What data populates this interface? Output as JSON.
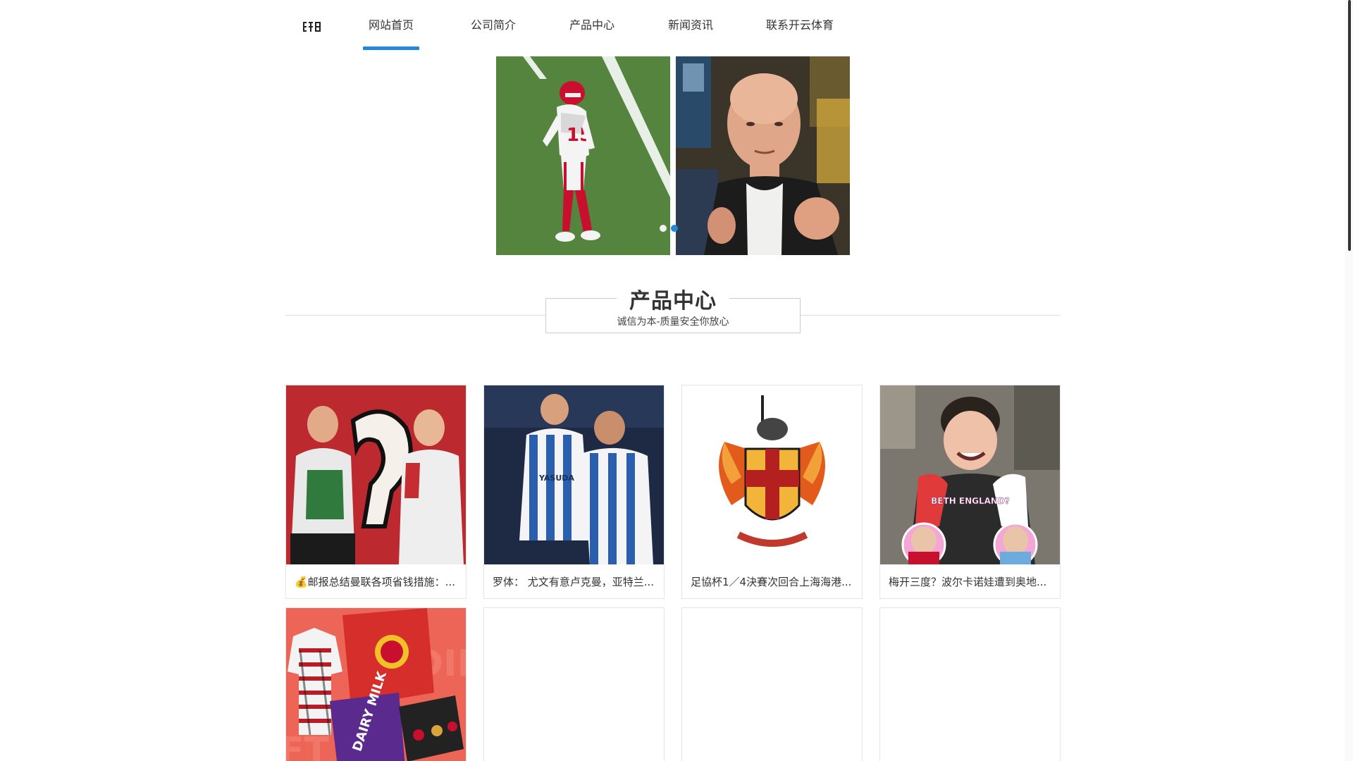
{
  "nav": {
    "items": [
      {
        "label": "网站首页",
        "active": true
      },
      {
        "label": "公司简介",
        "active": false
      },
      {
        "label": "产品中心",
        "active": false
      },
      {
        "label": "新闻资讯",
        "active": false
      },
      {
        "label": "联系开云体育",
        "active": false
      }
    ],
    "accent_color": "#2488d8"
  },
  "banner": {
    "slides": [
      {
        "image": "football-player-photo"
      },
      {
        "image": "man-speaking-photo"
      }
    ],
    "active_dot": 2,
    "dot_colors": {
      "inactive": "#ffffff",
      "active": "#2488d8"
    }
  },
  "section": {
    "title": "产品中心",
    "subtitle": "诚信为本-质量安全你放心"
  },
  "products": [
    {
      "caption": "💰邮报总结曼联各项省钱措施：..."
    },
    {
      "caption": "罗体： 尤文有意卢克曼，亚特兰..."
    },
    {
      "caption": "足協杯1／4決賽次回合上海海港..."
    },
    {
      "caption": "梅开三度？波尔卡诺娃遭到奥地..."
    },
    {
      "caption": ""
    },
    {
      "caption": ""
    },
    {
      "caption": ""
    },
    {
      "caption": ""
    }
  ],
  "product_image_text": {
    "card4": "BETH ENGLAND?",
    "card5": "DAIRY MILK"
  }
}
